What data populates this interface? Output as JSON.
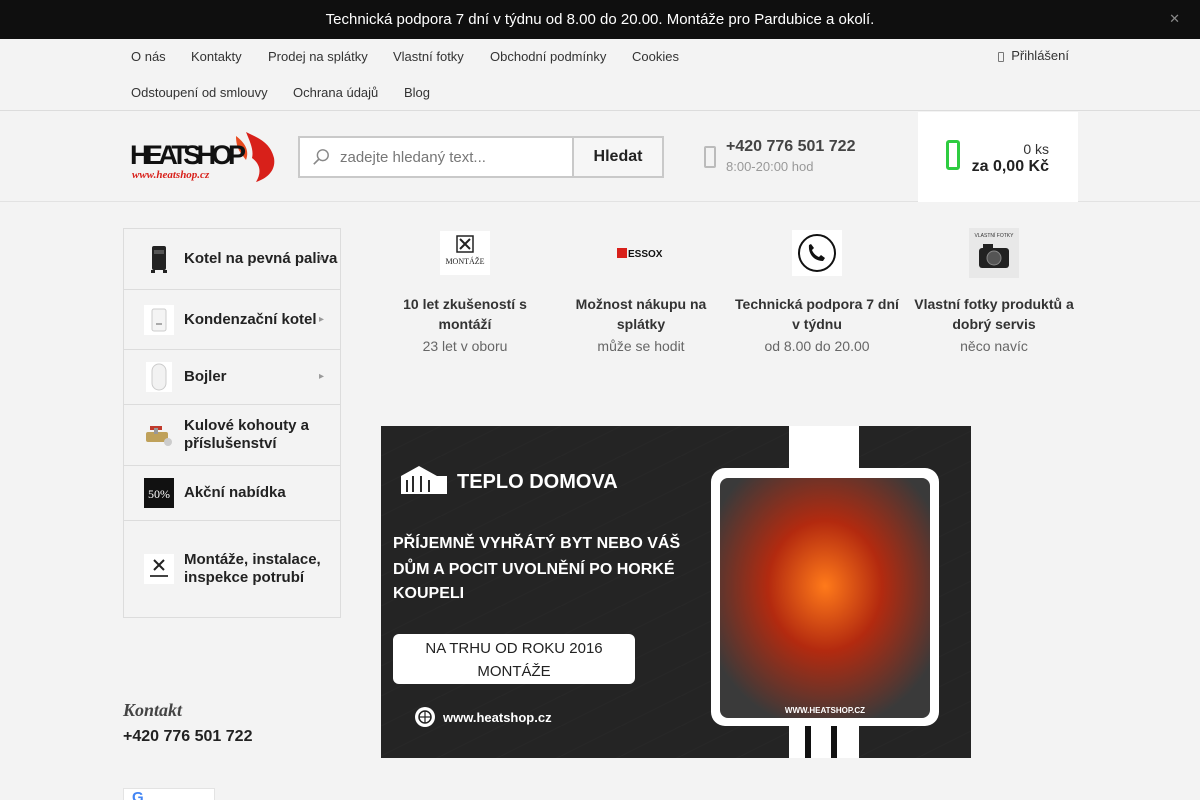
{
  "announcement": {
    "text": "Technická podpora 7 dní v týdnu od 8.00 do 20.00. Montáže pro Pardubice a okolí.",
    "close_icon": "close-icon"
  },
  "nav": {
    "row1": [
      "O nás",
      "Kontakty",
      "Prodej na splátky",
      "Vlastní fotky",
      "Obchodní podmínky",
      "Cookies"
    ],
    "row2": [
      "Odstoupení od smlouvy",
      "Ochrana údajů",
      "Blog"
    ],
    "login": "Přihlášení"
  },
  "header": {
    "logo_text": "HEATSHOP",
    "logo_url_text": "www.heatshop.cz",
    "search_placeholder": "zadejte hledaný text...",
    "search_button": "Hledat",
    "phone": "+420 776 501 722",
    "hours": "8:00-20:00 hod",
    "cart_qty": "0 ks",
    "cart_price": "za 0,00 Kč"
  },
  "categories": [
    {
      "label": "Kotel na pevná paliva",
      "icon": "boiler-stove-icon"
    },
    {
      "label": "Kondenzační kotel",
      "icon": "condensing-boiler-icon"
    },
    {
      "label": "Bojler",
      "icon": "water-heater-icon"
    },
    {
      "label": "Kulové kohouty a příslušenství",
      "icon": "ball-valve-icon"
    },
    {
      "label": "Akční nabídka",
      "icon": "sale-icon"
    },
    {
      "label": "Montáže, instalace, inspekce potrubí",
      "icon": "tools-icon"
    }
  ],
  "contact": {
    "heading": "Kontakt",
    "phone": "+420 776 501 722"
  },
  "benefits": [
    {
      "title": "10 let zkušeností s montáží",
      "subtitle": "23 let v oboru",
      "icon": "montaze-logo-icon",
      "icon_text": "MONTÁŽE"
    },
    {
      "title": "Možnost nákupu na splátky",
      "subtitle": "může se hodit",
      "icon": "essox-logo-icon",
      "icon_text": "ESSOX"
    },
    {
      "title": "Technická podpora 7 dní v týdnu",
      "subtitle": "od 8.00 do 20.00",
      "icon": "phone-icon"
    },
    {
      "title": "Vlastní fotky produktů a dobrý servis",
      "subtitle": "něco navíc",
      "icon": "camera-icon",
      "icon_text": "VLASTNÍ FOTKY"
    }
  ],
  "banner": {
    "brand": "TEPLO DOMOVA",
    "headline_lines": [
      "PŘÍJEMNĚ VYHŘÁTÝ BYT NEBO VÁŠ",
      "DŮM A POCIT UVOLNĚNÍ PO HORKÉ",
      "KOUPELI"
    ],
    "badge_lines": [
      "NA TRHU OD ROKU 2016",
      "MONTÁŽE"
    ],
    "url": "www.heatshop.cz",
    "photo_caption": "WWW.HEATSHOP.CZ"
  },
  "colors": {
    "topbar": "#0f0f0f",
    "cart_icon": "#2ecc40",
    "accent_red": "#d8201a"
  }
}
